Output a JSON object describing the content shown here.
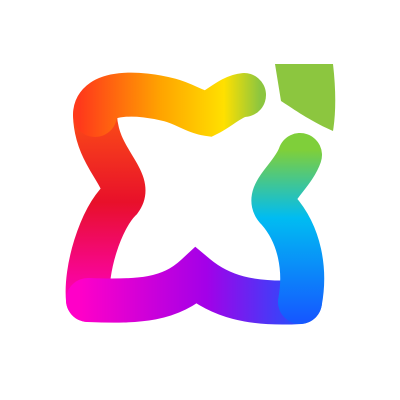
{
  "logo": {
    "icon": "rainbow-petal-logo-icon",
    "colors": {
      "background": "#ffffff",
      "red": "#e8102a",
      "orange": "#ff6a00",
      "yellow": "#ffe000",
      "green": "#8cc63f",
      "cyan": "#00bcf2",
      "blue": "#1559ff",
      "purple": "#a300e8",
      "magenta": "#ff00c8"
    }
  }
}
